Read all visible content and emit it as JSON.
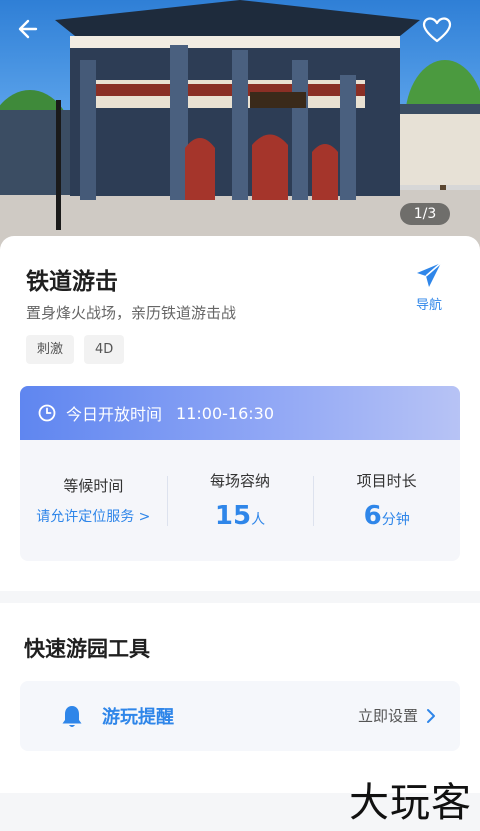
{
  "gallery": {
    "counter": "1/3"
  },
  "attraction": {
    "title": "铁道游击",
    "subtitle": "置身烽火战场，亲历铁道游击战",
    "tags": [
      "刺激",
      "4D"
    ],
    "nav_label": "导航"
  },
  "hours": {
    "label": "今日开放时间",
    "value": "11:00-16:30"
  },
  "stats": {
    "wait": {
      "label": "等候时间",
      "link": "请允许定位服务 >"
    },
    "capacity": {
      "label": "每场容纳",
      "value": "15",
      "unit": "人"
    },
    "duration": {
      "label": "项目时长",
      "value": "6",
      "unit": "分钟"
    }
  },
  "tools": {
    "title": "快速游园工具",
    "reminder_label": "游玩提醒",
    "reminder_action": "立即设置"
  },
  "watermark": "大玩客",
  "colors": {
    "accent": "#2f86e9",
    "hours_gradient_start": "#5f86f0"
  }
}
